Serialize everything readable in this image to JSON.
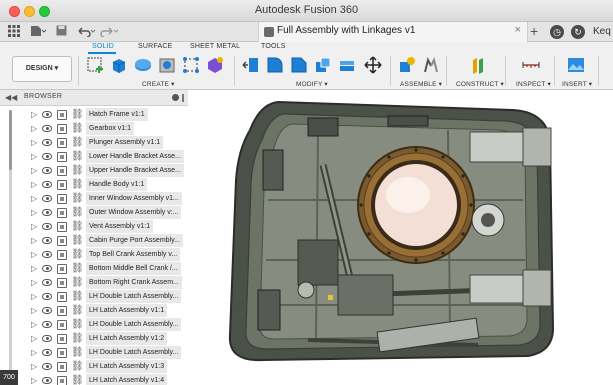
{
  "app": {
    "title": "Autodesk Fusion 360"
  },
  "tabbar": {
    "document_name": "Full Assembly with Linkages v1",
    "close_glyph": "×",
    "new_tab_glyph": "+",
    "user_label": "Keq"
  },
  "ribbon": {
    "tabs": [
      "SOLID",
      "SURFACE",
      "SHEET METAL",
      "TOOLS"
    ],
    "active_tab": "SOLID",
    "workspace_button": "DESIGN ▾",
    "groups": [
      "CREATE ▾",
      "MODIFY ▾",
      "ASSEMBLE ▾",
      "CONSTRUCT ▾",
      "INSPECT ▾",
      "INSERT ▾"
    ],
    "accent_color": "#0a84d6"
  },
  "browser": {
    "title": "BROWSER",
    "items": [
      "Hatch Frame v1:1",
      "Gearbox v1:1",
      "Plunger Assembly v1:1",
      "Lower Handle Bracket Asse...",
      "Upper Handle Bracket Asse...",
      "Handle Body v1:1",
      "Inner Window Assembly v1...",
      "Outer Window Assembly v:...",
      "Vent Assembly v1:1",
      "Cabin Purge Port Assembly...",
      "Top Bell Crank Assembly v...",
      "Bottom Middle Bell Crank /...",
      "Bottom Right Crank Assem...",
      "LH Double Latch Assembly...",
      "LH Latch Assembly v1:1",
      "LH Double Latch Assembly...",
      "LH Latch Assembly v1:2",
      "LH Double Latch Assembly...",
      "LH Latch Assembly v1:3",
      "LH Latch Assembly v1:4"
    ]
  },
  "viewport": {
    "zoom_readout": "700"
  }
}
